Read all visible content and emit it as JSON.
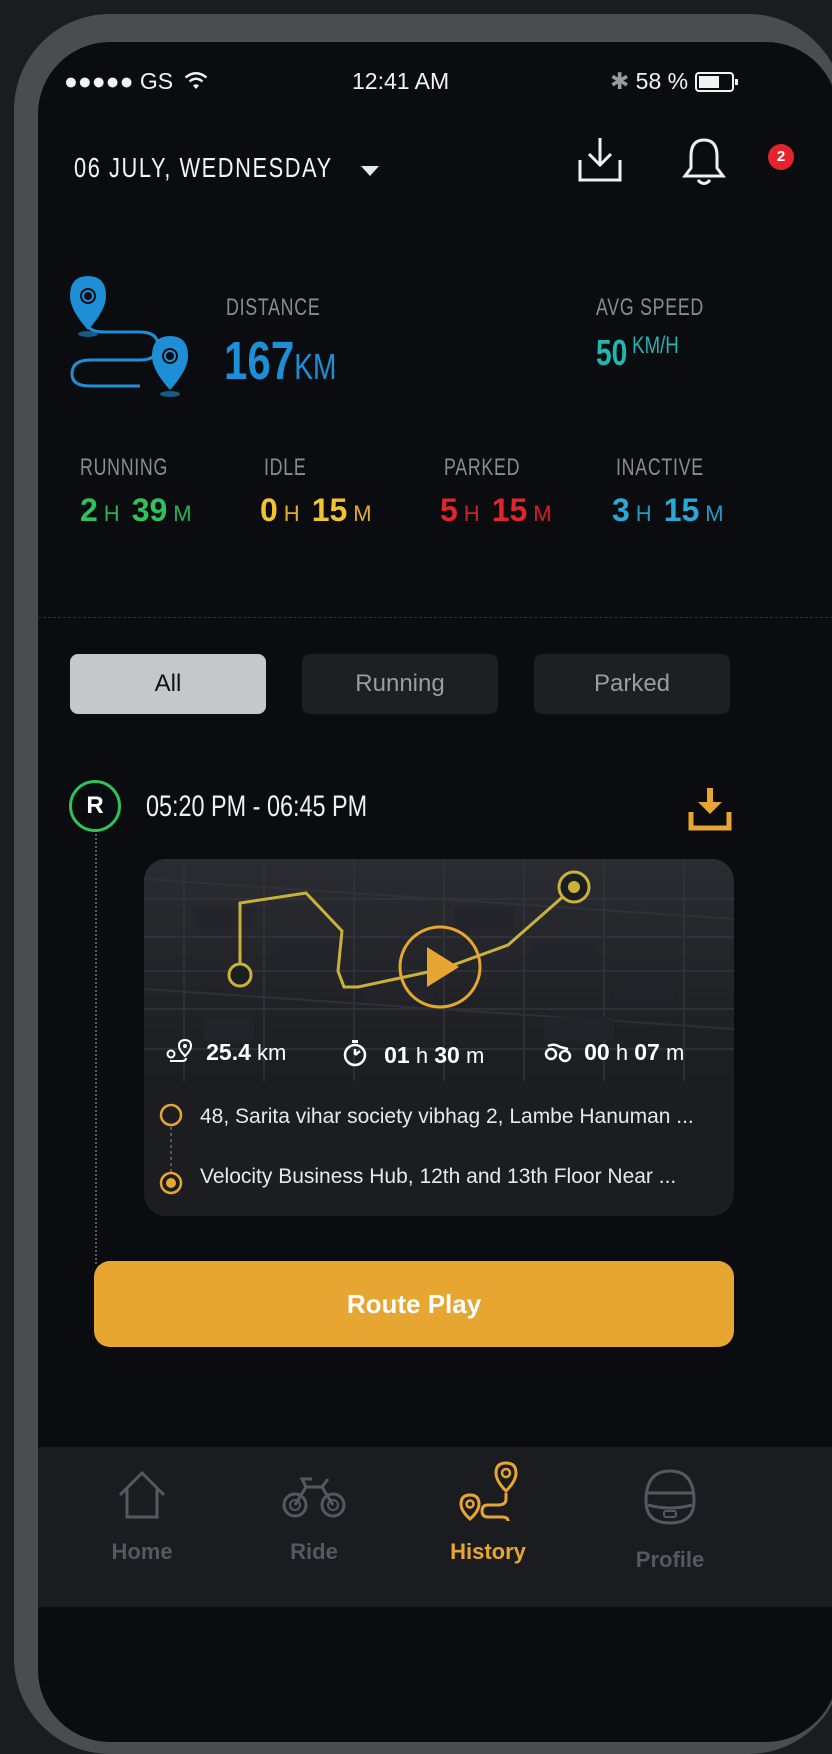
{
  "status_bar": {
    "carrier": "●●●●● GS",
    "time": "12:41 AM",
    "battery": "58 %"
  },
  "header": {
    "date": "06 JULY, WEDNESDAY",
    "notification_count": "2"
  },
  "summary": {
    "distance_label": "DISTANCE",
    "distance_value": "167",
    "distance_unit": "KM",
    "avg_speed_label": "AVG SPEED",
    "avg_speed_value": "50",
    "avg_speed_unit": "KM/H"
  },
  "durations": [
    {
      "label": "RUNNING",
      "h": "2",
      "m": "39",
      "h_unit": "H",
      "m_unit": "M",
      "color": "#2fc25a"
    },
    {
      "label": "IDLE",
      "h": "0",
      "m": "15",
      "h_unit": "H",
      "m_unit": "M",
      "color": "#f2c230"
    },
    {
      "label": "PARKED",
      "h": "5",
      "m": "15",
      "h_unit": "H",
      "m_unit": "M",
      "color": "#e3242b"
    },
    {
      "label": "INACTIVE",
      "h": "3",
      "m": "15",
      "h_unit": "H",
      "m_unit": "M",
      "color": "#2aa9d6"
    }
  ],
  "filters": {
    "all": "All",
    "running": "Running",
    "parked": "Parked"
  },
  "trip": {
    "badge": "R",
    "time_range": "05:20 PM - 06:45 PM",
    "distance": "25.4",
    "distance_unit": "km",
    "duration_h": "01",
    "duration_m": "30",
    "idle_h": "00",
    "idle_m": "07",
    "h_unit": "h",
    "m_unit": "m",
    "start_address": "48, Sarita vihar society vibhag 2, Lambe Hanuman ...",
    "end_address": "Velocity Business Hub, 12th and 13th Floor Near ..."
  },
  "route_play_label": "Route Play",
  "nav": {
    "home": "Home",
    "ride": "Ride",
    "history": "History",
    "profile": "Profile"
  },
  "colors": {
    "accent": "#e7a531",
    "distance_blue": "#1e8fd6",
    "speed_teal": "#22b5b0"
  }
}
